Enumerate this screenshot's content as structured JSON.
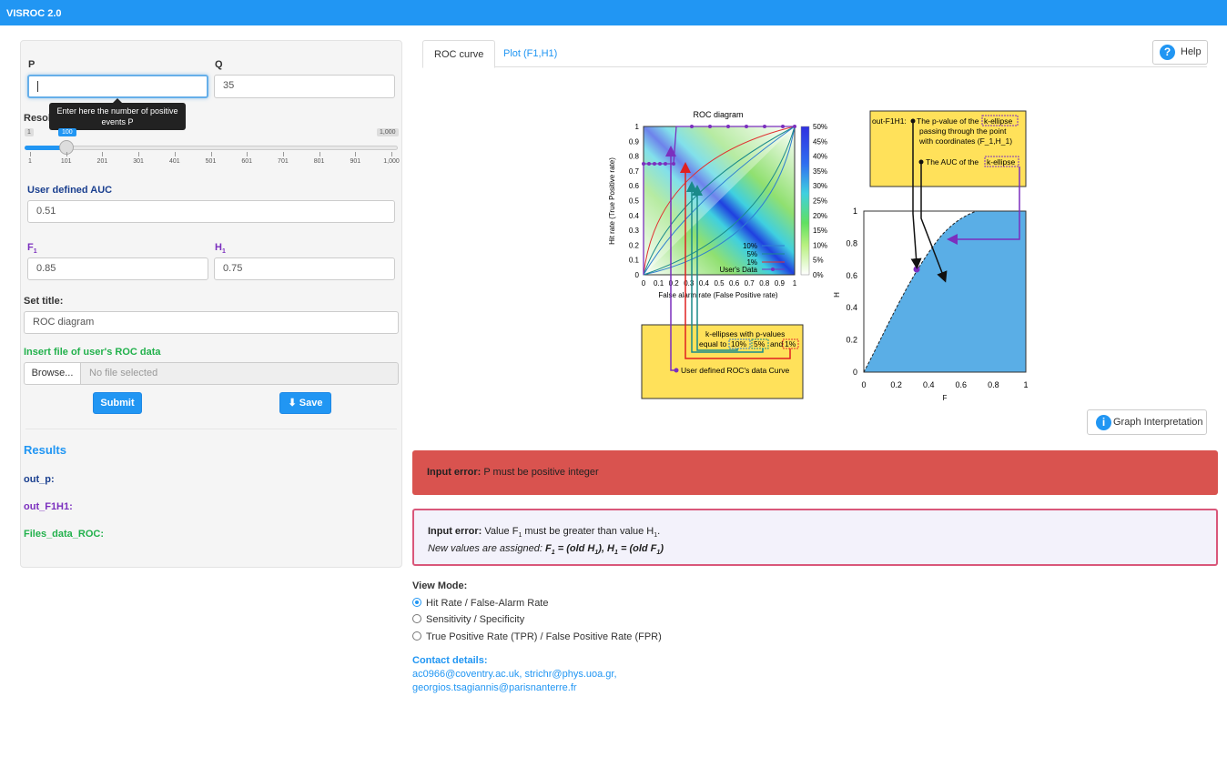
{
  "app": {
    "title": "VISROC 2.0"
  },
  "sidebar": {
    "p_label": "P",
    "p_value": "",
    "q_label": "Q",
    "q_value": "35",
    "tooltip": "Enter here the number of positive events P",
    "resolution_label": "Resolution",
    "slider": {
      "min_label": "1",
      "max_label": "1,000",
      "value_label": "100",
      "ticks": [
        "1",
        "101",
        "201",
        "301",
        "401",
        "501",
        "601",
        "701",
        "801",
        "901",
        "1,000"
      ],
      "value_fraction": 0.1
    },
    "auc_label": "User defined AUC",
    "auc_value": "0.51",
    "f1_label": "F",
    "f1_sub": "1",
    "f1_value": "0.85",
    "h1_label": "H",
    "h1_sub": "1",
    "h1_value": "0.75",
    "set_title_label": "Set title:",
    "title_value": "ROC diagram",
    "insert_file_label": "Insert file of user's ROC data",
    "browse_label": "Browse...",
    "file_placeholder": "No file selected",
    "submit_label": "Submit",
    "save_label": "Save",
    "results_title": "Results",
    "out_p": "out_p:",
    "out_f1h1": "out_F1H1:",
    "files_data": "Files_data_ROC:"
  },
  "tabs": [
    {
      "label": "ROC curve",
      "active": true
    },
    {
      "label": "Plot (F1,H1)",
      "active": false
    }
  ],
  "help_label": "Help",
  "graph_interpretation_label": "Graph Interpretation",
  "roc_chart": {
    "title": "ROC diagram",
    "xlabel": "False alarm rate (False Positive rate)",
    "ylabel": "Hit rate (True Positive rate)",
    "ticks": [
      "0",
      "0.1",
      "0.2",
      "0.3",
      "0.4",
      "0.5",
      "0.6",
      "0.7",
      "0.8",
      "0.9",
      "1"
    ],
    "colorbar_ticks": [
      "50%",
      "45%",
      "40%",
      "35%",
      "30%",
      "25%",
      "20%",
      "15%",
      "10%",
      "5%",
      "0%"
    ],
    "legend": [
      "10%",
      "5%",
      "1%",
      "User's Data"
    ],
    "note_box": {
      "line1": "k-ellipses with p-values",
      "line2a": "equal to",
      "v10": "10%",
      "v5": "5%",
      "line2b": "and",
      "v1": "1%",
      "line3": "User defined ROC's data Curve"
    }
  },
  "f1h1_chart": {
    "xlabel": "F",
    "ylabel": "H",
    "ticks": [
      "0",
      "0.2",
      "0.4",
      "0.6",
      "0.8",
      "1"
    ],
    "note_box": {
      "name": "out-F1H1:",
      "line1a": "The p-value of the",
      "line1b": "k-ellipse",
      "line2": "passing through the point",
      "line3": "with coordinates (F_1,H_1)",
      "line4a": "The  AUC of the",
      "line4b": "k-ellipse"
    }
  },
  "errors": {
    "red_bold": "Input error:",
    "red_text": "P must be positive integer",
    "box_bold": "Input error:",
    "box_text_a": "Value F",
    "box_text_b": " must be greater than value H",
    "box_line2a": "New values are assigned:",
    "box_line2b": "F",
    "box_line2c": " = (old H",
    "box_line2d": "), H",
    "box_line2e": " = (old F",
    "box_line2f": ")",
    "sub1": "1"
  },
  "view_mode": {
    "label": "View Mode:",
    "options": [
      "Hit Rate / False-Alarm Rate",
      "Sensitivity / Specificity",
      "True Positive Rate (TPR) / False Positive Rate (FPR)"
    ],
    "selected": 0
  },
  "contact": {
    "label": "Contact details:",
    "line1": "ac0966@coventry.ac.uk, strichr@phys.uoa.gr,",
    "line2": "georgios.tsagiannis@parisnanterre.fr"
  },
  "colors": {
    "accent": "#2196f3",
    "error_red": "#d9534f",
    "note_yellow": "#ffe15a",
    "f1h1_fill": "#5aaee6",
    "auc_green": "#22b14c",
    "purple": "#7b2fbe"
  }
}
